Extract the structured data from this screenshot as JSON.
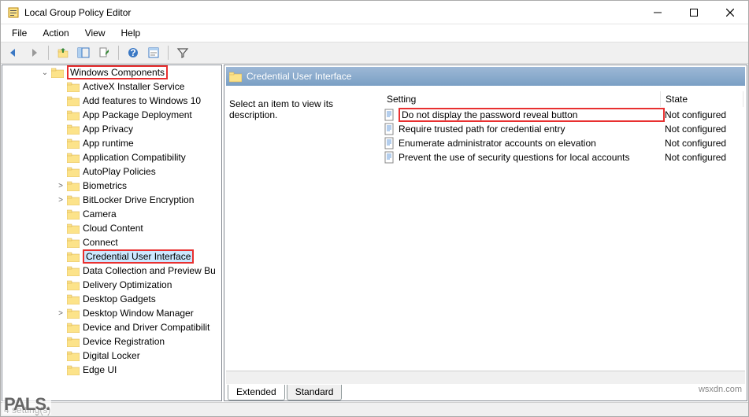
{
  "window": {
    "title": "Local Group Policy Editor"
  },
  "menu": {
    "items": [
      "File",
      "Action",
      "View",
      "Help"
    ]
  },
  "tree": {
    "root": "Windows Components",
    "items": [
      {
        "label": "ActiveX Installer Service",
        "expand": ""
      },
      {
        "label": "Add features to Windows 10",
        "expand": ""
      },
      {
        "label": "App Package Deployment",
        "expand": ""
      },
      {
        "label": "App Privacy",
        "expand": ""
      },
      {
        "label": "App runtime",
        "expand": ""
      },
      {
        "label": "Application Compatibility",
        "expand": ""
      },
      {
        "label": "AutoPlay Policies",
        "expand": ""
      },
      {
        "label": "Biometrics",
        "expand": ">"
      },
      {
        "label": "BitLocker Drive Encryption",
        "expand": ">"
      },
      {
        "label": "Camera",
        "expand": ""
      },
      {
        "label": "Cloud Content",
        "expand": ""
      },
      {
        "label": "Connect",
        "expand": ""
      },
      {
        "label": "Credential User Interface",
        "expand": "",
        "selected": true,
        "highlight": true
      },
      {
        "label": "Data Collection and Preview Bu",
        "expand": ""
      },
      {
        "label": "Delivery Optimization",
        "expand": ""
      },
      {
        "label": "Desktop Gadgets",
        "expand": ""
      },
      {
        "label": "Desktop Window Manager",
        "expand": ">"
      },
      {
        "label": "Device and Driver Compatibilit",
        "expand": ""
      },
      {
        "label": "Device Registration",
        "expand": ""
      },
      {
        "label": "Digital Locker",
        "expand": ""
      },
      {
        "label": "Edge UI",
        "expand": ""
      }
    ]
  },
  "details": {
    "header": "Credential User Interface",
    "description": "Select an item to view its description.",
    "columns": {
      "setting": "Setting",
      "state": "State"
    },
    "settings": [
      {
        "name": "Do not display the password reveal button",
        "state": "Not configured",
        "highlight": true
      },
      {
        "name": "Require trusted path for credential entry",
        "state": "Not configured"
      },
      {
        "name": "Enumerate administrator accounts on elevation",
        "state": "Not configured"
      },
      {
        "name": "Prevent the use of security questions for local accounts",
        "state": "Not configured"
      }
    ]
  },
  "tabs": {
    "items": [
      "Extended",
      "Standard"
    ],
    "active": 0
  },
  "statusbar": {
    "text": "4 setting(s)"
  },
  "watermark": "wsxdn.com",
  "logo": "PALS."
}
